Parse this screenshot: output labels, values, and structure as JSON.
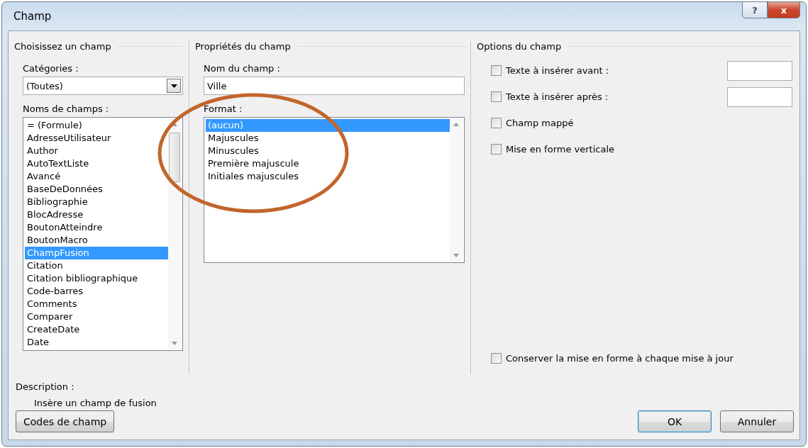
{
  "window": {
    "title": "Champ",
    "help_button": "?",
    "close_button": "x"
  },
  "choose_field": {
    "title": "Choisissez un champ",
    "categories_label": "Catégories :",
    "categories_value": "(Toutes)",
    "names_label": "Noms de champs :",
    "names": [
      {
        "label": "= (Formule)",
        "selected": false
      },
      {
        "label": "AdresseUtilisateur",
        "selected": false
      },
      {
        "label": "Author",
        "selected": false
      },
      {
        "label": "AutoTextListe",
        "selected": false
      },
      {
        "label": "Avancé",
        "selected": false
      },
      {
        "label": "BaseDeDonnées",
        "selected": false
      },
      {
        "label": "Bibliographie",
        "selected": false
      },
      {
        "label": "BlocAdresse",
        "selected": false
      },
      {
        "label": "BoutonAtteindre",
        "selected": false
      },
      {
        "label": "BoutonMacro",
        "selected": false
      },
      {
        "label": "ChampFusion",
        "selected": true
      },
      {
        "label": "Citation",
        "selected": false
      },
      {
        "label": "Citation bibliographique",
        "selected": false
      },
      {
        "label": "Code-barres",
        "selected": false
      },
      {
        "label": "Comments",
        "selected": false
      },
      {
        "label": "Comparer",
        "selected": false
      },
      {
        "label": "CreateDate",
        "selected": false
      },
      {
        "label": "Date",
        "selected": false
      }
    ]
  },
  "properties": {
    "title": "Propriétés du champ",
    "name_label": "Nom du champ :",
    "name_value": "Ville",
    "format_label": "Format :",
    "formats": [
      {
        "label": "(aucun)",
        "selected": true
      },
      {
        "label": "Majuscules",
        "selected": false
      },
      {
        "label": "Minuscules",
        "selected": false
      },
      {
        "label": "Première majuscule",
        "selected": false
      },
      {
        "label": "Initiales majuscules",
        "selected": false
      }
    ]
  },
  "options": {
    "title": "Options du champ",
    "items": [
      {
        "kind": "with-field",
        "label": "Texte à insérer avant :",
        "checked": false
      },
      {
        "kind": "with-field",
        "label": "Texte à insérer après :",
        "checked": false
      },
      {
        "kind": "plain",
        "label": "Champ mappé",
        "checked": false
      },
      {
        "kind": "plain",
        "label": "Mise en forme verticale",
        "checked": false
      }
    ],
    "keep_format": {
      "label": "Conserver la mise en forme à chaque mise à jour",
      "checked": false
    }
  },
  "description": {
    "label": "Description :",
    "text": "Insère un champ de fusion"
  },
  "buttons": [
    {
      "kind": "left",
      "label": "Codes de champ"
    },
    {
      "kind": "default",
      "label": "OK"
    },
    {
      "kind": "normal",
      "label": "Annuler"
    }
  ],
  "annotation": {
    "kind": "ellipse"
  }
}
